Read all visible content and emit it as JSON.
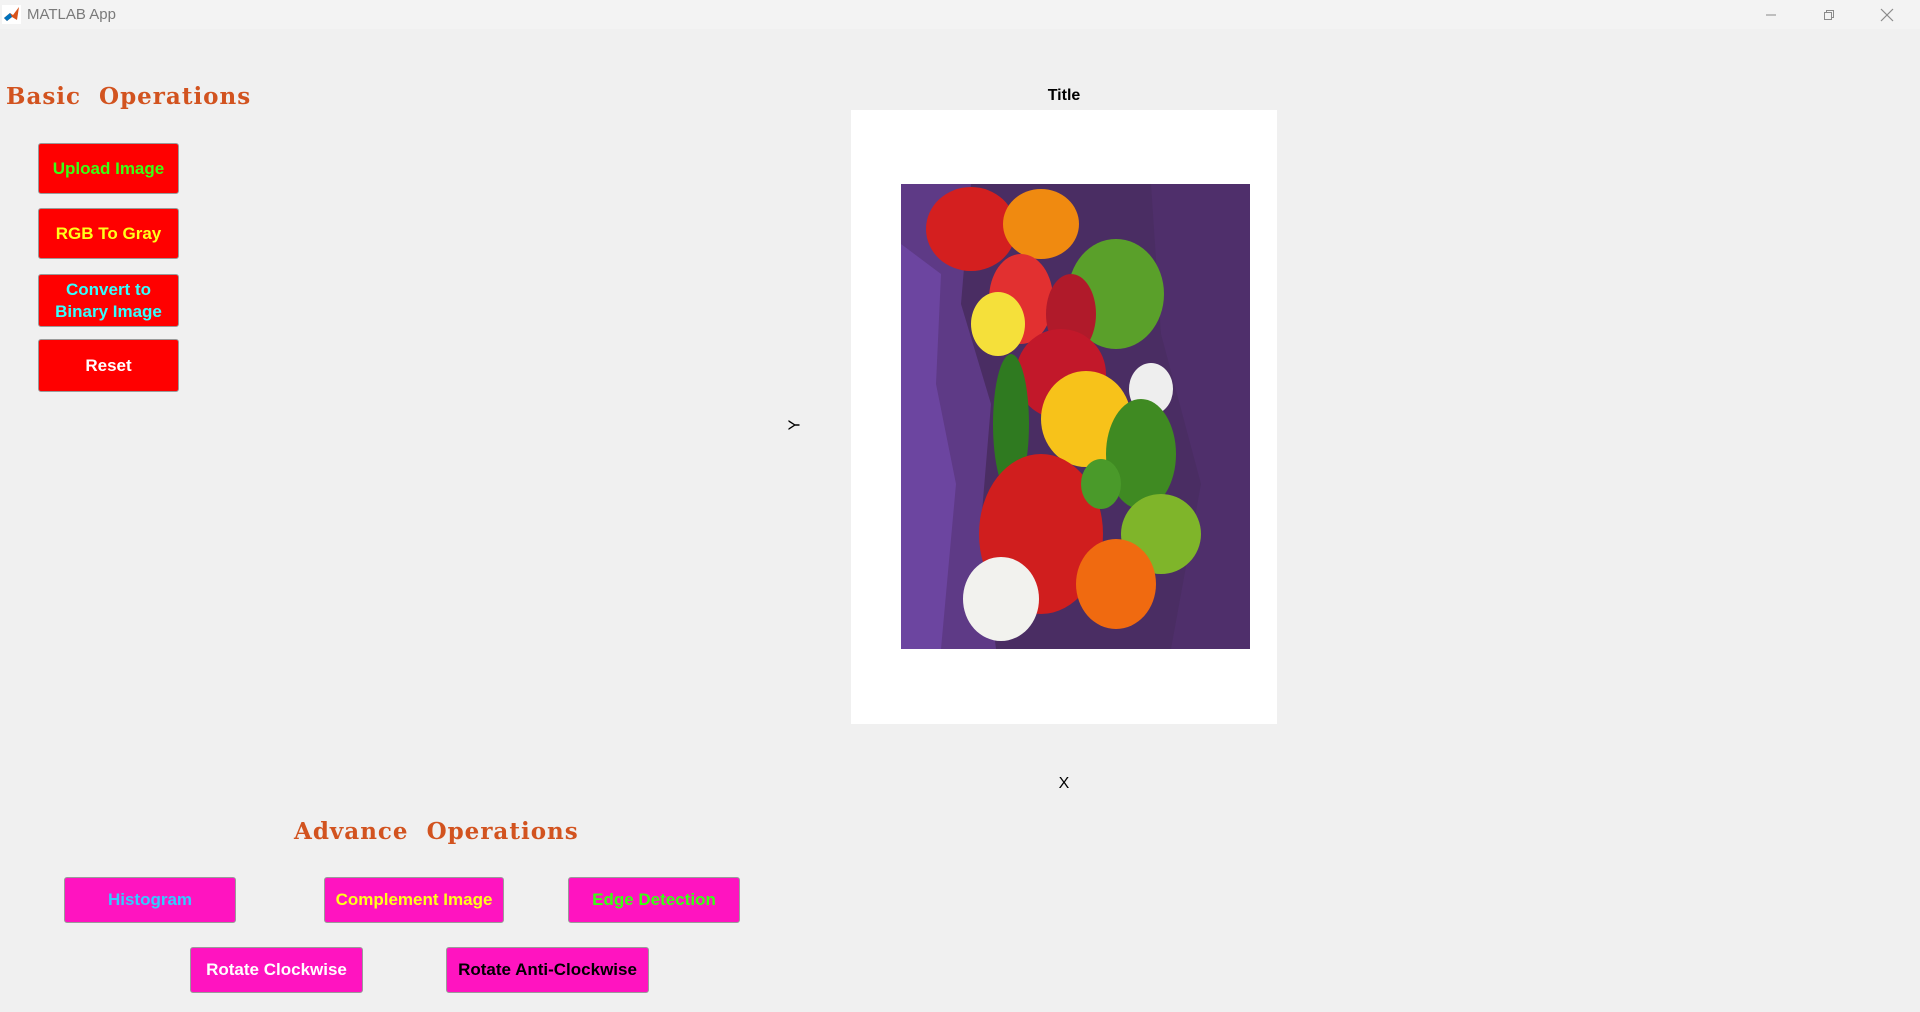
{
  "window": {
    "title": "MATLAB App"
  },
  "basic": {
    "heading": "Basic  Operations",
    "buttons": {
      "upload": "Upload Image",
      "rgb_to_gray": "RGB To Gray",
      "binary_line1": "Convert to",
      "binary_line2": "Binary Image",
      "reset": "Reset"
    }
  },
  "advance": {
    "heading": "Advance  Operations",
    "buttons": {
      "histogram": "Histogram",
      "complement": "Complement Image",
      "edge": "Edge Detection",
      "rotate_cw": "Rotate Clockwise",
      "rotate_acw": "Rotate Anti-Clockwise"
    }
  },
  "axes": {
    "title": "Title",
    "xlabel": "X",
    "ylabel": "Y",
    "image_subject": "peppers-photo"
  },
  "colors": {
    "basic_button_bg": "#ff0000",
    "advance_button_bg": "#ff14c0",
    "heading_color": "#d2531f"
  }
}
